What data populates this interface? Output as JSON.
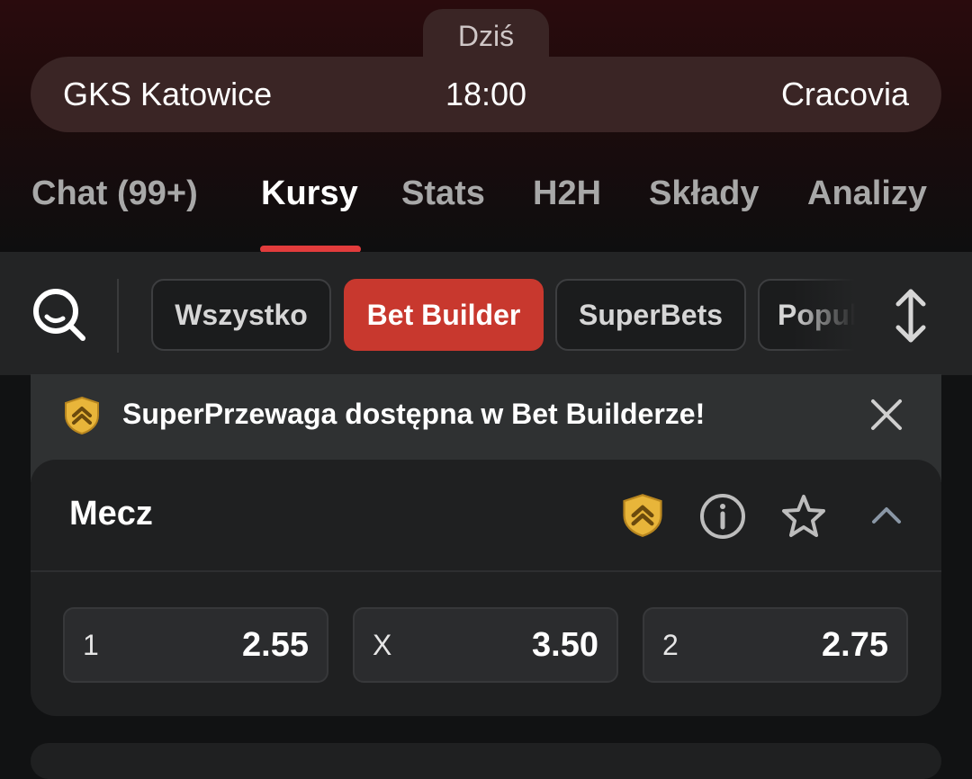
{
  "header": {
    "day_label": "Dziś",
    "home_team": "GKS Katowice",
    "time": "18:00",
    "away_team": "Cracovia"
  },
  "tabs": [
    {
      "label": "Chat (99+)",
      "active": false
    },
    {
      "label": "Kursy",
      "active": true
    },
    {
      "label": "Stats",
      "active": false
    },
    {
      "label": "H2H",
      "active": false
    },
    {
      "label": "Składy",
      "active": false
    },
    {
      "label": "Analizy",
      "active": false
    }
  ],
  "filters": {
    "chips": [
      {
        "label": "Wszystko",
        "active": false
      },
      {
        "label": "Bet Builder",
        "active": true
      },
      {
        "label": "SuperBets",
        "active": false
      },
      {
        "label": "Popularne",
        "active": false
      }
    ]
  },
  "banner": {
    "text": "SuperPrzewaga dostępna w Bet Builderze!"
  },
  "market": {
    "title": "Mecz",
    "odds": [
      {
        "label": "1",
        "value": "2.55"
      },
      {
        "label": "X",
        "value": "3.50"
      },
      {
        "label": "2",
        "value": "2.75"
      }
    ]
  },
  "colors": {
    "accent": "#e23c3c",
    "active_chip": "#c8382e",
    "shield_gold": "#e8b53a"
  },
  "icons": {
    "search": "search-icon",
    "sort": "sort-arrows-icon",
    "shield": "super-advantage-shield-icon",
    "close": "close-icon",
    "info": "info-icon",
    "star": "star-icon",
    "collapse": "chevron-up-icon"
  }
}
